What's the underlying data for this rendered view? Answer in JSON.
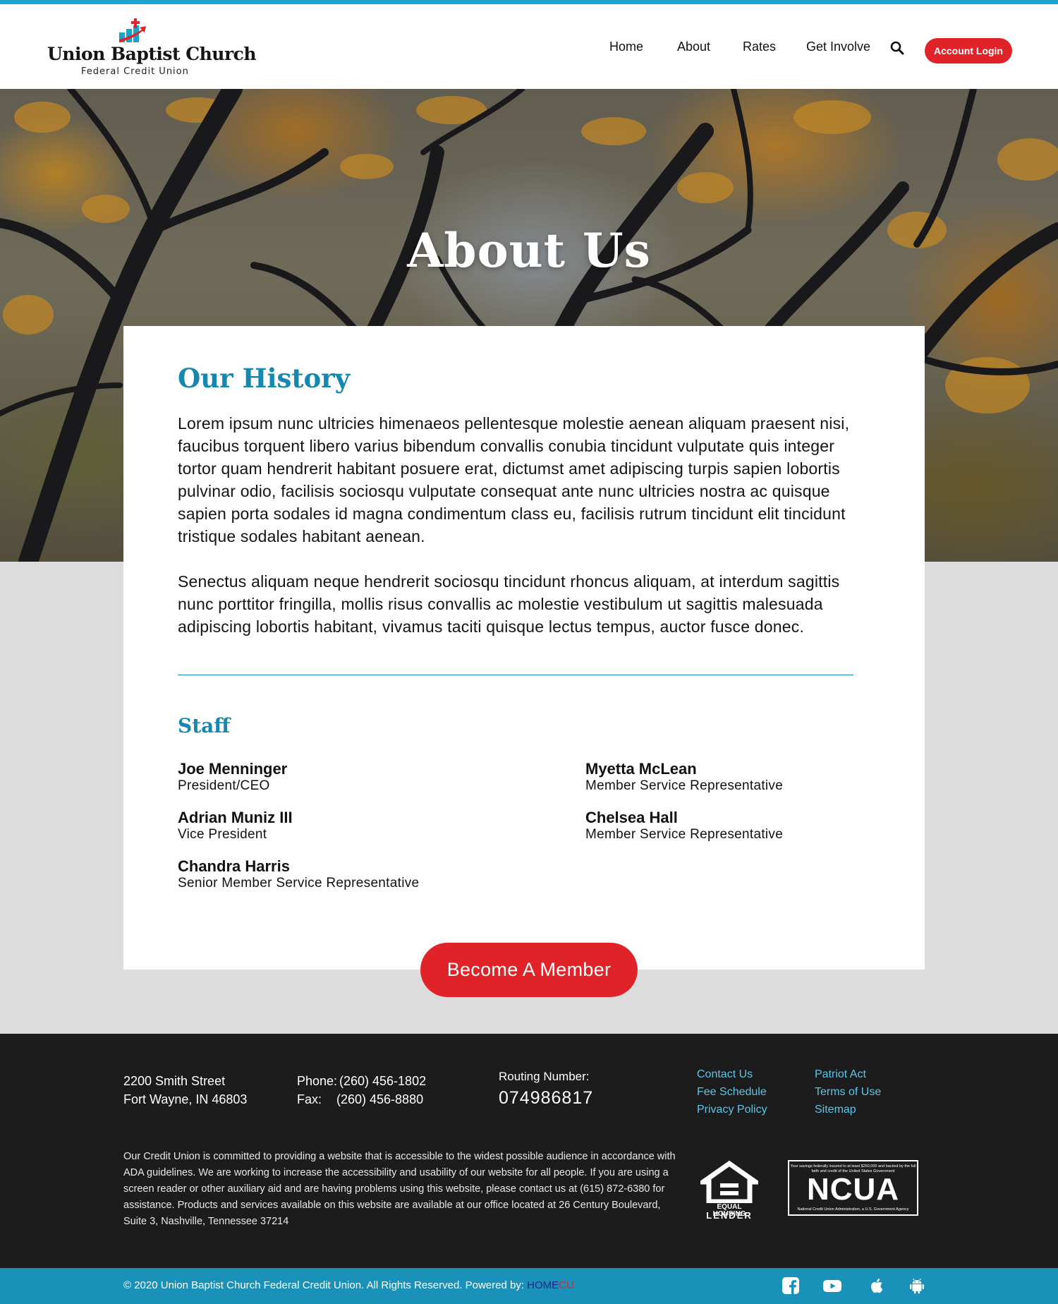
{
  "header": {
    "logo_name": "Union Baptist Church",
    "logo_sub": "Federal Credit Union",
    "nav": [
      {
        "label": "Home"
      },
      {
        "label": "About"
      },
      {
        "label": "Rates"
      },
      {
        "label": "Get Involve"
      }
    ],
    "search_icon": "search-icon",
    "login_label": "Account Login"
  },
  "hero": {
    "title": "About Us"
  },
  "history": {
    "heading": "Our History",
    "paragraph1": "Lorem ipsum nunc ultricies himenaeos pellentesque molestie aenean aliquam praesent nisi, faucibus torquent libero varius bibendum convallis conubia tincidunt vulputate quis integer tortor quam hendrerit habitant posuere erat, dictumst amet adipiscing turpis sapien lobortis pulvinar odio, facilisis sociosqu vulputate consequat ante nunc ultricies nostra ac quisque sapien porta sodales id magna condimentum class eu, facilisis rutrum tincidunt elit tincidunt tristique sodales habitant aenean.",
    "paragraph2": "Senectus aliquam neque hendrerit sociosqu tincidunt rhoncus aliquam, at interdum sagittis nunc porttitor fringilla, mollis risus convallis ac molestie vestibulum ut sagittis malesuada adipiscing lobortis habitant, vivamus taciti quisque lectus tempus, auctor fusce donec."
  },
  "staff": {
    "heading": "Staff",
    "members": [
      {
        "name": "Joe Menninger",
        "title": "President/CEO"
      },
      {
        "name": "Adrian Muniz III",
        "title": "Vice President"
      },
      {
        "name": "Chandra Harris",
        "title": "Senior Member Service Representative"
      },
      {
        "name": "Myetta McLean",
        "title": "Member Service Representative"
      },
      {
        "name": "Chelsea Hall",
        "title": "Member Service Representative"
      }
    ]
  },
  "cta": {
    "label": "Become A Member"
  },
  "footer": {
    "address_line1": "2200 Smith Street",
    "address_line2": "Fort Wayne, IN 46803",
    "phone_label": "Phone:",
    "phone": "(260) 456-1802",
    "fax_label": "Fax:",
    "fax": "(260) 456-8880",
    "routing_label": "Routing Number:",
    "routing_number": "074986817",
    "links_col1": [
      "Contact Us",
      "Fee Schedule",
      "Privacy Policy"
    ],
    "links_col2": [
      "Patriot Act",
      "Terms of Use",
      "Sitemap"
    ],
    "ada_text": "Our Credit Union is committed to providing a website that is accessible to the widest possible audience in accordance with ADA guidelines. We are working to increase the accessibility and usability of our website for all people. If you are using a screen reader or other auxiliary aid and are having problems using this website, please contact us at (615) 872-6380 for assistance. Products and services available on this website are available at our office located at 26 Century Boulevard, Suite 3, Nashville, Tennessee 37214",
    "eho_line1": "EQUAL HOUSING",
    "eho_line2": "LENDER",
    "ncua_top": "Your savings federally insured to at least $250,000 and backed by the full faith and credit of the United States Government",
    "ncua_big": "NCUA",
    "ncua_bottom": "National Credit Union Administration, a U.S. Government Agency"
  },
  "bottom": {
    "copyright": "© 2020 Union Baptist Church Federal Credit Union. All Rights Reserved.  Powered by: ",
    "brand_home": "HOME",
    "brand_cu": "CU",
    "social": [
      "facebook-icon",
      "youtube-icon",
      "apple-icon",
      "android-icon"
    ]
  },
  "colors": {
    "accent": "#1688b0",
    "top_bar": "#1aa3cf",
    "button_red": "#e02328",
    "footer_bg": "#1c1c1c",
    "bottom_bar": "#1a91b8",
    "link": "#5ec4e6"
  }
}
